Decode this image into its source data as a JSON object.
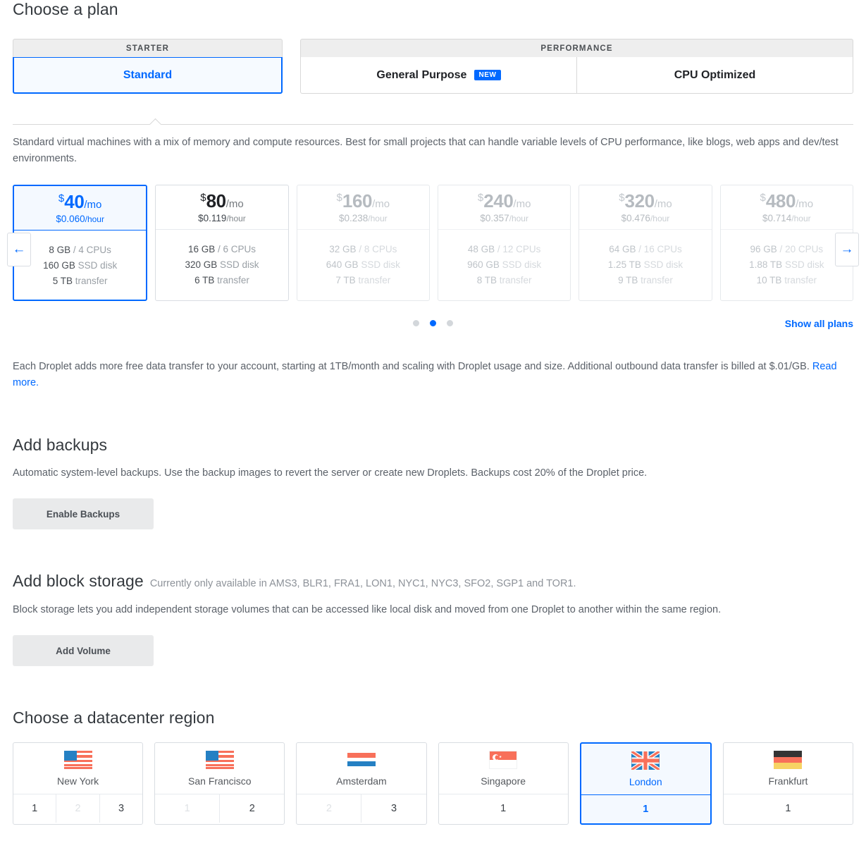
{
  "plan_section": {
    "title": "Choose a plan",
    "tab_groups": [
      {
        "header": "STARTER",
        "tabs": [
          {
            "label": "Standard",
            "selected": true,
            "badge": ""
          }
        ]
      },
      {
        "header": "PERFORMANCE",
        "tabs": [
          {
            "label": "General Purpose",
            "selected": false,
            "badge": "NEW"
          },
          {
            "label": "CPU Optimized",
            "selected": false,
            "badge": ""
          }
        ]
      }
    ],
    "description": "Standard virtual machines with a mix of memory and compute resources. Best for small projects that can handle variable levels of CPU performance, like blogs, web apps and dev/test environments.",
    "prev_arrow": "←",
    "next_arrow": "→",
    "show_all_plans": "Show all plans",
    "dots": [
      {
        "active": false
      },
      {
        "active": true
      },
      {
        "active": false
      }
    ],
    "plans": [
      {
        "dollar": "$",
        "amount": "40",
        "per": "/mo",
        "hourly_price": "$0.060",
        "hourly_unit": "/hour",
        "memory": "8 GB",
        "cpu": "4 CPUs",
        "disk_size": "160 GB",
        "disk_label": "SSD disk",
        "transfer_size": "5 TB",
        "transfer_label": "transfer",
        "selected": true,
        "faded": false
      },
      {
        "dollar": "$",
        "amount": "80",
        "per": "/mo",
        "hourly_price": "$0.119",
        "hourly_unit": "/hour",
        "memory": "16 GB",
        "cpu": "6 CPUs",
        "disk_size": "320 GB",
        "disk_label": "SSD disk",
        "transfer_size": "6 TB",
        "transfer_label": "transfer",
        "selected": false,
        "faded": false
      },
      {
        "dollar": "$",
        "amount": "160",
        "per": "/mo",
        "hourly_price": "$0.238",
        "hourly_unit": "/hour",
        "memory": "32 GB",
        "cpu": "8 CPUs",
        "disk_size": "640 GB",
        "disk_label": "SSD disk",
        "transfer_size": "7 TB",
        "transfer_label": "transfer",
        "selected": false,
        "faded": true
      },
      {
        "dollar": "$",
        "amount": "240",
        "per": "/mo",
        "hourly_price": "$0.357",
        "hourly_unit": "/hour",
        "memory": "48 GB",
        "cpu": "12 CPUs",
        "disk_size": "960 GB",
        "disk_label": "SSD disk",
        "transfer_size": "8 TB",
        "transfer_label": "transfer",
        "selected": false,
        "faded": true
      },
      {
        "dollar": "$",
        "amount": "320",
        "per": "/mo",
        "hourly_price": "$0.476",
        "hourly_unit": "/hour",
        "memory": "64 GB",
        "cpu": "16 CPUs",
        "disk_size": "1.25 TB",
        "disk_label": "SSD disk",
        "transfer_size": "9 TB",
        "transfer_label": "transfer",
        "selected": false,
        "faded": true
      },
      {
        "dollar": "$",
        "amount": "480",
        "per": "/mo",
        "hourly_price": "$0.714",
        "hourly_unit": "/hour",
        "memory": "96 GB",
        "cpu": "20 CPUs",
        "disk_size": "1.88 TB",
        "disk_label": "SSD disk",
        "transfer_size": "10 TB",
        "transfer_label": "transfer",
        "selected": false,
        "faded": true
      }
    ],
    "transfer_note_part1": "Each Droplet adds more free data transfer to your account, starting at 1TB/month and scaling with Droplet usage and size. Additional outbound data transfer is billed at $.01/GB. ",
    "transfer_note_link": "Read more.",
    "transfer_note_part2": ""
  },
  "backups_section": {
    "title": "Add backups",
    "description": "Automatic system-level backups. Use the backup images to revert the server or create new Droplets. Backups cost 20% of the Droplet price.",
    "button_label": "Enable Backups"
  },
  "block_storage_section": {
    "title": "Add block storage",
    "availability_note": "Currently only available in AMS3, BLR1, FRA1, LON1, NYC1, NYC3, SFO2, SGP1 and TOR1.",
    "description": "Block storage lets you add independent storage volumes that can be accessed like local disk and moved from one Droplet to another within the same region.",
    "button_label": "Add Volume"
  },
  "region_section": {
    "title": "Choose a datacenter region",
    "regions": [
      {
        "name": "New York",
        "flag": "us-flag-icon",
        "selected": false,
        "numbers": [
          {
            "label": "1",
            "disabled": false
          },
          {
            "label": "2",
            "disabled": true
          },
          {
            "label": "3",
            "disabled": false
          }
        ]
      },
      {
        "name": "San Francisco",
        "flag": "us-flag-icon",
        "selected": false,
        "numbers": [
          {
            "label": "1",
            "disabled": true
          },
          {
            "label": "2",
            "disabled": false
          }
        ]
      },
      {
        "name": "Amsterdam",
        "flag": "netherlands-flag-icon",
        "selected": false,
        "numbers": [
          {
            "label": "2",
            "disabled": true
          },
          {
            "label": "3",
            "disabled": false
          }
        ]
      },
      {
        "name": "Singapore",
        "flag": "singapore-flag-icon",
        "selected": false,
        "numbers": [
          {
            "label": "1",
            "disabled": false
          }
        ]
      },
      {
        "name": "London",
        "flag": "uk-flag-icon",
        "selected": true,
        "numbers": [
          {
            "label": "1",
            "disabled": false
          }
        ]
      },
      {
        "name": "Frankfurt",
        "flag": "germany-flag-icon",
        "selected": false,
        "numbers": [
          {
            "label": "1",
            "disabled": false
          }
        ]
      }
    ]
  },
  "colors": {
    "accent_blue": "#0069ff",
    "selected_bg": "#f4f9ff",
    "border": "#d9dde2",
    "muted_text": "#9aa0a6",
    "flag_red": "#f8705a",
    "flag_blue": "#2580c3",
    "flag_yellow": "#f7d364",
    "flag_black": "#343434"
  }
}
